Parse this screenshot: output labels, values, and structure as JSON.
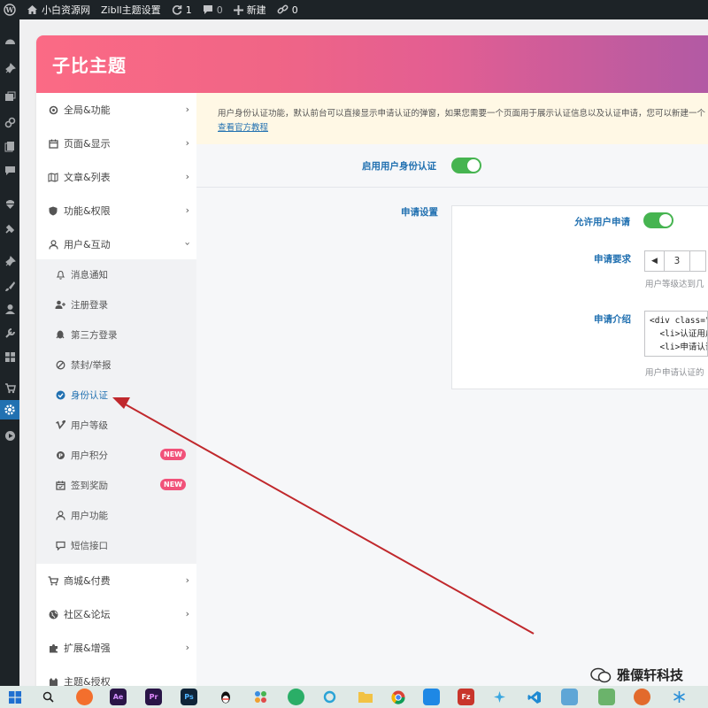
{
  "adminbar": {
    "site_name": "小白资源网",
    "theme_settings": "Zibll主题设置",
    "updates_count": "1",
    "comments_count": "0",
    "new_label": "新建",
    "links_count": "0"
  },
  "header": {
    "title": "子比主题"
  },
  "sidebar": {
    "items": [
      {
        "label": "全局&功能",
        "icon": "gear-icon"
      },
      {
        "label": "页面&显示",
        "icon": "calendar-icon"
      },
      {
        "label": "文章&列表",
        "icon": "map-icon"
      },
      {
        "label": "功能&权限",
        "icon": "shield-icon"
      },
      {
        "label": "用户&互动",
        "icon": "user-icon"
      }
    ],
    "sub_items": [
      {
        "label": "消息通知",
        "icon": "bell-icon"
      },
      {
        "label": "注册登录",
        "icon": "user-plus-icon"
      },
      {
        "label": "第三方登录",
        "icon": "qq-icon"
      },
      {
        "label": "禁封/举报",
        "icon": "ban-icon"
      },
      {
        "label": "身份认证",
        "icon": "check-circle-icon"
      },
      {
        "label": "用户等级",
        "icon": "vimeo-icon"
      },
      {
        "label": "用户积分",
        "icon": "points-icon",
        "badge": "NEW"
      },
      {
        "label": "签到奖励",
        "icon": "calendar-check-icon",
        "badge": "NEW"
      },
      {
        "label": "用户功能",
        "icon": "user-icon"
      },
      {
        "label": "短信接口",
        "icon": "chat-icon"
      }
    ],
    "bottom_items": [
      {
        "label": "商城&付费",
        "icon": "cart-icon"
      },
      {
        "label": "社区&论坛",
        "icon": "globe-icon"
      },
      {
        "label": "扩展&增强",
        "icon": "puzzle-icon"
      },
      {
        "label": "主题&授权",
        "icon": "cat-icon"
      }
    ]
  },
  "content": {
    "notice_text": "用户身份认证功能，默认前台可以直接显示申请认证的弹窗，如果您需要一个页面用于展示认证信息以及认证申请，您可以新建一个",
    "notice_link": "查看官方教程",
    "enable_label": "启用用户身份认证",
    "enable_value": true,
    "apply_settings_label": "申请设置",
    "allow_apply_label": "允许用户申请",
    "allow_apply_value": true,
    "requirement_label": "申请要求",
    "requirement_value": "3",
    "requirement_hint": "用户等级达到几",
    "intro_label": "申请介绍",
    "intro_code": "<div class=\"n\n  <li>认证用户\n  <li>申请认证",
    "intro_hint": "用户申请认证的"
  },
  "watermark": {
    "text": "雅僳轩科技"
  },
  "colors": {
    "accent": "#2271b1",
    "toggle_on": "#46b450",
    "badge": "#f1527a",
    "header_start": "#fb6a85",
    "header_end": "#b25aa4",
    "annotation_arrow": "#c0282c"
  }
}
